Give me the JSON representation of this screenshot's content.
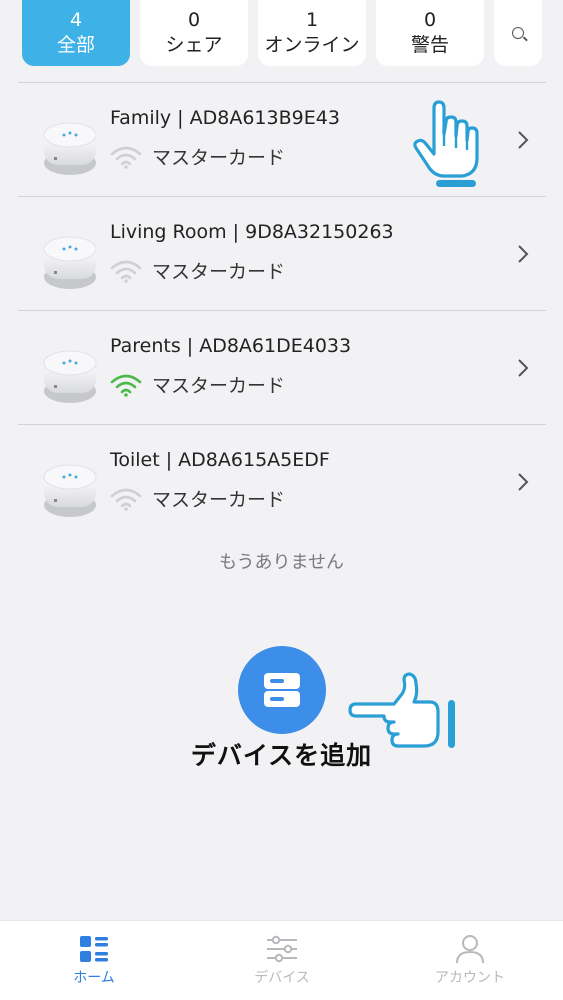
{
  "tabs": [
    {
      "count": "4",
      "label": "全部",
      "active": true
    },
    {
      "count": "0",
      "label": "シェア",
      "active": false
    },
    {
      "count": "1",
      "label": "オンライン",
      "active": false
    },
    {
      "count": "0",
      "label": "警告",
      "active": false
    }
  ],
  "search": {
    "icon": "search-icon"
  },
  "devices": [
    {
      "name": "Family | AD8A613B9E43",
      "status": "マスターカード",
      "wifi": "offline"
    },
    {
      "name": "Living Room | 9D8A32150263",
      "status": "マスターカード",
      "wifi": "offline"
    },
    {
      "name": "Parents | AD8A61DE4033",
      "status": "マスターカード",
      "wifi": "online"
    },
    {
      "name": "Toilet | AD8A615A5EDF",
      "status": "マスターカード",
      "wifi": "offline"
    }
  ],
  "list_end_text": "もうありません",
  "add_device": {
    "label": "デバイスを追加"
  },
  "bottom_nav": [
    {
      "label": "ホーム",
      "icon": "home-grid-icon",
      "active": true
    },
    {
      "label": "デバイス",
      "icon": "sliders-icon",
      "active": false
    },
    {
      "label": "アカウント",
      "icon": "user-icon",
      "active": false
    }
  ],
  "colors": {
    "accent": "#3eb2e6",
    "add_button": "#3d8ee8",
    "wifi_online": "#4cb84a",
    "wifi_offline": "#d0d0d4",
    "nav_active": "#2f7fe0"
  }
}
